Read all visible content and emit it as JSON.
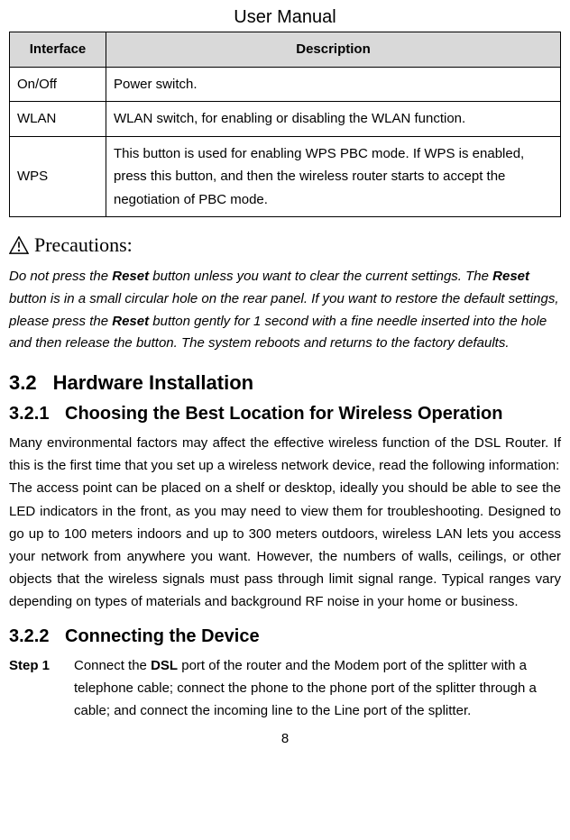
{
  "header": {
    "title": "User Manual"
  },
  "table": {
    "headers": {
      "interface": "Interface",
      "description": "Description"
    },
    "rows": [
      {
        "interface": "On/Off",
        "description": "Power switch."
      },
      {
        "interface": "WLAN",
        "description": "WLAN switch, for enabling or disabling the WLAN function."
      },
      {
        "interface": "WPS",
        "description": "This button is used for enabling WPS PBC mode. If WPS is enabled, press this button, and then the wireless router starts to accept the negotiation of PBC mode."
      }
    ]
  },
  "precautions": {
    "heading": "Precautions:",
    "body_parts": {
      "p1": "Do not press the ",
      "b1": "Reset",
      "p2": " button unless you want to clear the current settings. The ",
      "b2": "Reset",
      "p3": " button is in a small circular hole on the rear panel. If you want to restore the default settings, please press the ",
      "b3": "Reset",
      "p4": " button gently for 1 second with a fine needle inserted into the hole and then release the button. The system reboots and returns to the factory defaults."
    }
  },
  "sections": {
    "s32": {
      "num": "3.2",
      "title": "Hardware Installation"
    },
    "s321": {
      "num": "3.2.1",
      "title": "Choosing the Best Location for Wireless Operation",
      "para1": "Many environmental factors may affect the effective wireless function of the DSL Router. If this is the first time that you set up a wireless network device, read the following information:",
      "para2": "The access point can be placed on a shelf or desktop, ideally you should be able to see the LED indicators in the front, as you may need to view them for troubleshooting. Designed to go up to 100 meters indoors and up to 300 meters outdoors, wireless LAN lets you access your network from anywhere you want. However, the numbers of walls, ceilings, or other objects that the wireless signals must pass through limit signal range. Typical ranges vary depending on types of materials and background RF noise in your home or business."
    },
    "s322": {
      "num": "3.2.2",
      "title": "Connecting the Device",
      "step1": {
        "label": "Step 1",
        "t1": "Connect the ",
        "b1": "DSL",
        "t2": " port of the router and the Modem port of the splitter with a telephone cable; connect the phone to the phone port of the splitter through a cable; and connect the incoming line to the Line port of the splitter."
      }
    }
  },
  "page_number": "8"
}
